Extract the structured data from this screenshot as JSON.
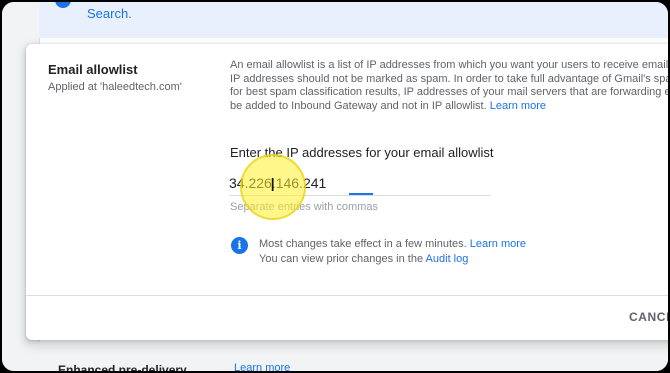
{
  "top_banner": {
    "link": "Search."
  },
  "card": {
    "title": "Email allowlist",
    "subtitle": "Applied at 'haleedtech.com'",
    "description_lines": [
      "An email allowlist is a list of IP addresses from which you want your users to receive emails. M",
      "IP addresses should not be marked as spam. In order to take full advantage of Gmail's spam filt",
      "for best spam classification results, IP addresses of your mail servers that are forwarding emai",
      "be added to Inbound Gateway and not in IP allowlist."
    ],
    "description_link": "Learn more",
    "field_label": "Enter the IP addresses for your email allowlist",
    "ip_value": "34.226.146.241",
    "hint": "Separate entries with commas",
    "info_icon": "info-icon",
    "info_line1": "Most changes take effect in a few minutes.",
    "info_line1_link": "Learn more",
    "info_line2": "You can view prior changes in the",
    "info_line2_link": "Audit log",
    "cancel_label": "CANCEL"
  },
  "below": {
    "row_title": "Enhanced pre-delivery",
    "row_link": "Learn more"
  },
  "colors": {
    "accent": "#1a73e8",
    "highlight": "#fff028"
  }
}
